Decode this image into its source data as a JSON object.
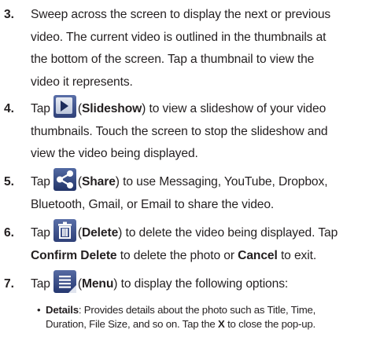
{
  "steps": [
    {
      "number": "3.",
      "lines": [
        "Sweep across the screen to display the next or previous",
        "video. The current video is outlined in the thumbnails at",
        "the bottom of the screen. Tap a thumbnail to view the",
        "video it represents."
      ]
    },
    {
      "number": "4.",
      "tap": "Tap",
      "icon": "slideshow-icon",
      "name": "Slideshow",
      "rest": ") to view a slideshow of your video",
      "lines": [
        "thumbnails. Touch the screen to stop the slideshow and",
        "view the video being displayed."
      ]
    },
    {
      "number": "5.",
      "tap": "Tap",
      "icon": "share-icon",
      "name": "Share",
      "rest": ") to use Messaging, YouTube, Dropbox,",
      "lines": [
        "Bluetooth, Gmail, or Email to share the video."
      ]
    },
    {
      "number": "6.",
      "tap": "Tap",
      "icon": "trash-icon",
      "name": "Delete",
      "rest": ") to delete the video being displayed. Tap",
      "line2_bold1": "Confirm Delete",
      "line2_mid": " to delete the photo or ",
      "line2_bold2": "Cancel",
      "line2_end": " to exit."
    },
    {
      "number": "7.",
      "tap": "Tap",
      "icon": "menu-icon",
      "name": "Menu",
      "rest": ") to display the following options:"
    }
  ],
  "bullet": {
    "marker": "•",
    "label": "Details",
    "line1_rest": ": Provides details about the photo such as Title, Time,",
    "line2_start": "Duration, File Size, and so on. Tap the ",
    "line2_bold": "X",
    "line2_end": " to close the pop-up."
  }
}
